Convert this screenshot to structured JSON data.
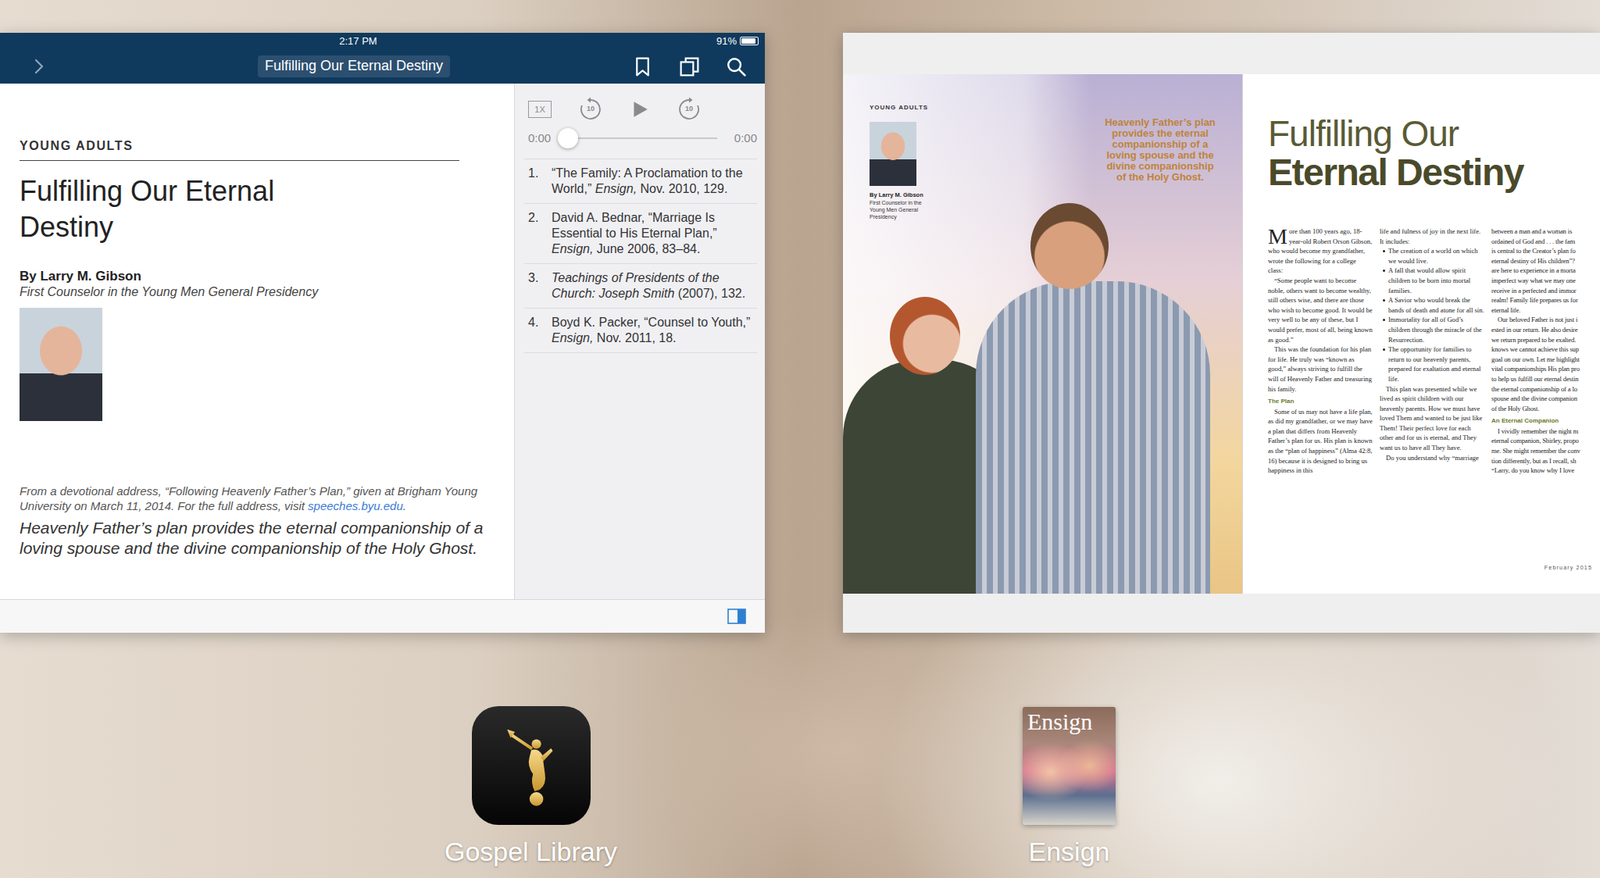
{
  "status_bar": {
    "time": "2:17 PM",
    "battery": "91%",
    "battery_level": 0.91
  },
  "gospel_library_window": {
    "nav_title": "Fulfilling Our Eternal Destiny",
    "article": {
      "section": "YOUNG ADULTS",
      "title": "Fulfilling Our Eternal Destiny",
      "author": "By Larry M. Gibson",
      "author_role": "First Counselor in the Young Men General Presidency",
      "source_note": "From a devotional address, “Following Heavenly Father’s Plan,” given at Brigham Young University on March 11, 2014. For the full address, visit ",
      "source_link": "speeches.byu.edu",
      "source_end": ".",
      "intro": "Heavenly Father’s plan provides the eternal companionship of a loving spouse and the divine companionship of the Holy Ghost."
    },
    "player": {
      "speed": "1X",
      "rewind": "10",
      "forward": "10",
      "playing": false,
      "level": 0,
      "elapsed": "0:00",
      "total": "0:00"
    },
    "notes": [
      {
        "number": "1.",
        "parts": [
          {
            "text": "“The Family: A Proclamation to the World,” ",
            "italic": false
          },
          {
            "text": "Ensign,",
            "italic": true
          },
          {
            "text": " Nov. 2010, 129.",
            "italic": false
          }
        ]
      },
      {
        "number": "2.",
        "parts": [
          {
            "text": "David A. Bednar, “Marriage Is Essential to His Eternal Plan,” ",
            "italic": false
          },
          {
            "text": "Ensign,",
            "italic": true
          },
          {
            "text": " June 2006, 83–84.",
            "italic": false
          }
        ]
      },
      {
        "number": "3.",
        "parts": [
          {
            "text": "Teachings of Presidents of the Church: Joseph Smith",
            "italic": true
          },
          {
            "text": " (2007), 132.",
            "italic": false
          }
        ]
      },
      {
        "number": "4.",
        "parts": [
          {
            "text": "Boyd K. Packer, “Counsel to Youth,” ",
            "italic": false
          },
          {
            "text": "Ensign,",
            "italic": true
          },
          {
            "text": " Nov. 2011, 18.",
            "italic": false
          }
        ]
      }
    ]
  },
  "ensign_window": {
    "left_page": {
      "section": "YOUNG ADULTS",
      "author": "By Larry M. Gibson",
      "author_role": "First Counselor in the Young Men General Presidency",
      "pull_quote": "Heavenly Father’s plan provides the eternal companionship of a loving spouse and the divine companionship of the Holy Ghost."
    },
    "right_page": {
      "title_line1": "Fulfilling Our",
      "title_line2": "Eternal Destiny",
      "columns": [
        {
          "blocks": [
            {
              "kind": "lead",
              "initial": "M",
              "text": "ore than 100 years ago, 18-year-old Robert Orson Gibson, who would become my grandfather, wrote the following for a college class:"
            },
            {
              "kind": "paragraph",
              "text": "“Some people want to become noble, others want to become wealthy, still others wise, and there are those who wish to become good. It would be very well to be any of these, but I would prefer, most of all, being known as good.”"
            },
            {
              "kind": "paragraph",
              "text": "This was the foundation for his plan for life. He truly was “known as good,” always striving to fulfill the will of Heavenly Father and treasuring his family."
            },
            {
              "kind": "heading",
              "text": "The Plan"
            },
            {
              "kind": "paragraph",
              "text": "Some of us may not have a life plan, as did my grandfather, or we may have a plan that differs from Heavenly Father’s plan for us. His plan is known as the “plan of happiness” (Alma 42:8, 16) because it is designed to bring us happiness in this"
            }
          ]
        },
        {
          "blocks": [
            {
              "kind": "continued",
              "text": "life and fulness of joy in the next life. It includes:"
            },
            {
              "kind": "bullet",
              "text": "The creation of a world on which we would live."
            },
            {
              "kind": "bullet",
              "text": "A fall that would allow spirit children to be born into mortal families."
            },
            {
              "kind": "bullet",
              "text": "A Savior who would break the bands of death and atone for all sin."
            },
            {
              "kind": "bullet",
              "text": "Immortality for all of God’s children through the miracle of the Resurrection."
            },
            {
              "kind": "bullet",
              "text": "The opportunity for families to return to our heavenly parents, prepared for exaltation and eternal life."
            },
            {
              "kind": "paragraph",
              "text": "This plan was presented while we lived as spirit children with our heavenly parents. How we must have loved Them and wanted to be just like Them! Their perfect love for each other and for us is eternal, and They want us to have all They have."
            },
            {
              "kind": "paragraph",
              "text": "Do you understand why “marriage"
            }
          ]
        },
        {
          "blocks": [
            {
              "kind": "line",
              "text": "between a man and a woman is"
            },
            {
              "kind": "line",
              "text": "ordained of God and . . . the fam"
            },
            {
              "kind": "line",
              "text": "is central to the Creator’s plan fo"
            },
            {
              "kind": "line",
              "text": "eternal destiny of His children”?"
            },
            {
              "kind": "line",
              "text": "are here to experience in a morta"
            },
            {
              "kind": "line",
              "text": "imperfect way what we may one"
            },
            {
              "kind": "line",
              "text": "receive in a perfected and immor"
            },
            {
              "kind": "line",
              "text": "realm! Family life prepares us for"
            },
            {
              "kind": "line",
              "text": "eternal life."
            },
            {
              "kind": "first-line",
              "text": "Our beloved Father is not just i"
            },
            {
              "kind": "line",
              "text": "ested in our return. He also desire"
            },
            {
              "kind": "line",
              "text": "we return prepared to be exalted."
            },
            {
              "kind": "line",
              "text": "knows we cannot achieve this sup"
            },
            {
              "kind": "line",
              "text": "goal on our own. Let me highlight"
            },
            {
              "kind": "line",
              "text": "vital companionships His plan pro"
            },
            {
              "kind": "line",
              "text": "to help us fulfill our eternal destin"
            },
            {
              "kind": "line",
              "text": "the eternal companionship of a lo"
            },
            {
              "kind": "line",
              "text": "spouse and the divine companion"
            },
            {
              "kind": "line",
              "text": "of the Holy Ghost."
            },
            {
              "kind": "heading",
              "text": "An Eternal Companion"
            },
            {
              "kind": "first-line",
              "text": "I vividly remember the night m"
            },
            {
              "kind": "line",
              "text": "eternal companion, Shirley, propo"
            },
            {
              "kind": "line",
              "text": "me. She might remember the conv"
            },
            {
              "kind": "line",
              "text": "tion differently, but as I recall, sh"
            },
            {
              "kind": "line",
              "text": "“Larry, do you know why I love"
            }
          ]
        }
      ],
      "footer": "February 2015"
    }
  },
  "dock": [
    {
      "kind": "gospel-library",
      "label": "Gospel Library"
    },
    {
      "kind": "ensign",
      "label": "Ensign",
      "cover_title": "Ensign"
    }
  ]
}
